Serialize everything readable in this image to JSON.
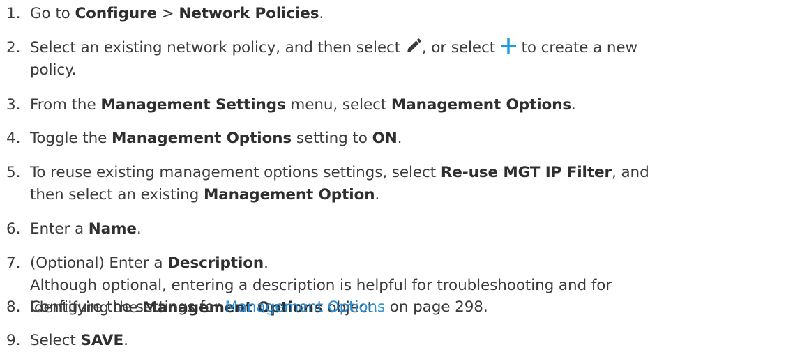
{
  "steps": [
    {
      "num": "1.",
      "t1": "Go to ",
      "b1": "Configure",
      "t2": " > ",
      "b2": "Network Policies",
      "t3": "."
    },
    {
      "num": "2.",
      "t1": "Select an existing network policy, and then select ",
      "t2": ", or select ",
      "t3": " to create a new",
      "t4": "policy."
    },
    {
      "num": "3.",
      "t1": "From the ",
      "b1": "Management Settings",
      "t2": " menu, select ",
      "b2": "Management Options",
      "t3": "."
    },
    {
      "num": "4.",
      "t1": "Toggle the ",
      "b1": "Management Options",
      "t2": " setting to ",
      "b2": "ON",
      "t3": "."
    },
    {
      "num": "5.",
      "t1": "To reuse existing management options settings, select ",
      "b1": "Re-use MGT IP Filter",
      "t2": ", and",
      "t3": "then select an existing ",
      "b2": "Management Option",
      "t4": "."
    },
    {
      "num": "6.",
      "t1": "Enter a ",
      "b1": "Name",
      "t2": "."
    },
    {
      "num": "7.",
      "t1": "(Optional) Enter a ",
      "b1": "Description",
      "t2": ".",
      "t3": "Although optional, entering a description is helpful for troubleshooting and for",
      "t4": "identifying the ",
      "b2": "Management Options",
      "t5": " object."
    },
    {
      "num": "8.",
      "t1": "Configure the settings for ",
      "link": "Management Options",
      "t2": " on page 298."
    },
    {
      "num": "9.",
      "t1": "Select ",
      "b1": "SAVE",
      "t2": "."
    }
  ],
  "icons": {
    "edit": "pencil-icon",
    "add": "plus-icon"
  },
  "colors": {
    "text": "#3b3b3b",
    "link": "#2a8fd6",
    "plus_icon": "#1a9ee0",
    "pencil_icon": "#3b3b3b"
  }
}
